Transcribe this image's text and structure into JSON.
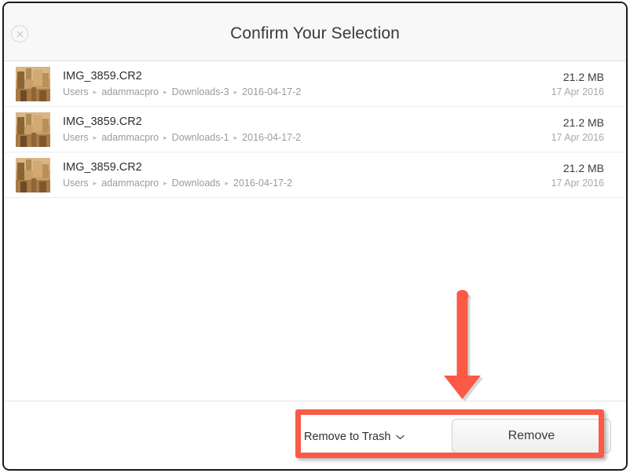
{
  "window": {
    "header": {
      "title": "Confirm Your Selection",
      "close_icon": "close-circle-icon"
    }
  },
  "file_list": {
    "path_separator": "▸",
    "rows": [
      {
        "name": "IMG_3859.CR2",
        "path": [
          "Users",
          "adammacpro",
          "Downloads-3",
          "2016-04-17-2"
        ],
        "size": "21.2 MB",
        "date": "17 Apr 2016",
        "thumbnail": "photo-thumbnail"
      },
      {
        "name": "IMG_3859.CR2",
        "path": [
          "Users",
          "adammacpro",
          "Downloads-1",
          "2016-04-17-2"
        ],
        "size": "21.2 MB",
        "date": "17 Apr 2016",
        "thumbnail": "photo-thumbnail"
      },
      {
        "name": "IMG_3859.CR2",
        "path": [
          "Users",
          "adammacpro",
          "Downloads",
          "2016-04-17-2"
        ],
        "size": "21.2 MB",
        "date": "17 Apr 2016",
        "thumbnail": "photo-thumbnail"
      }
    ]
  },
  "footer": {
    "action_select": {
      "value": "Remove to Trash",
      "chevron_icon": "chevron-down-icon",
      "options": [
        "Remove to Trash"
      ]
    },
    "primary_button": {
      "label": "Remove"
    }
  },
  "annotations": {
    "highlight_color": "#fa5a46",
    "arrow_icon": "down-arrow-annotation",
    "box_icon": "highlight-rectangle-annotation"
  }
}
